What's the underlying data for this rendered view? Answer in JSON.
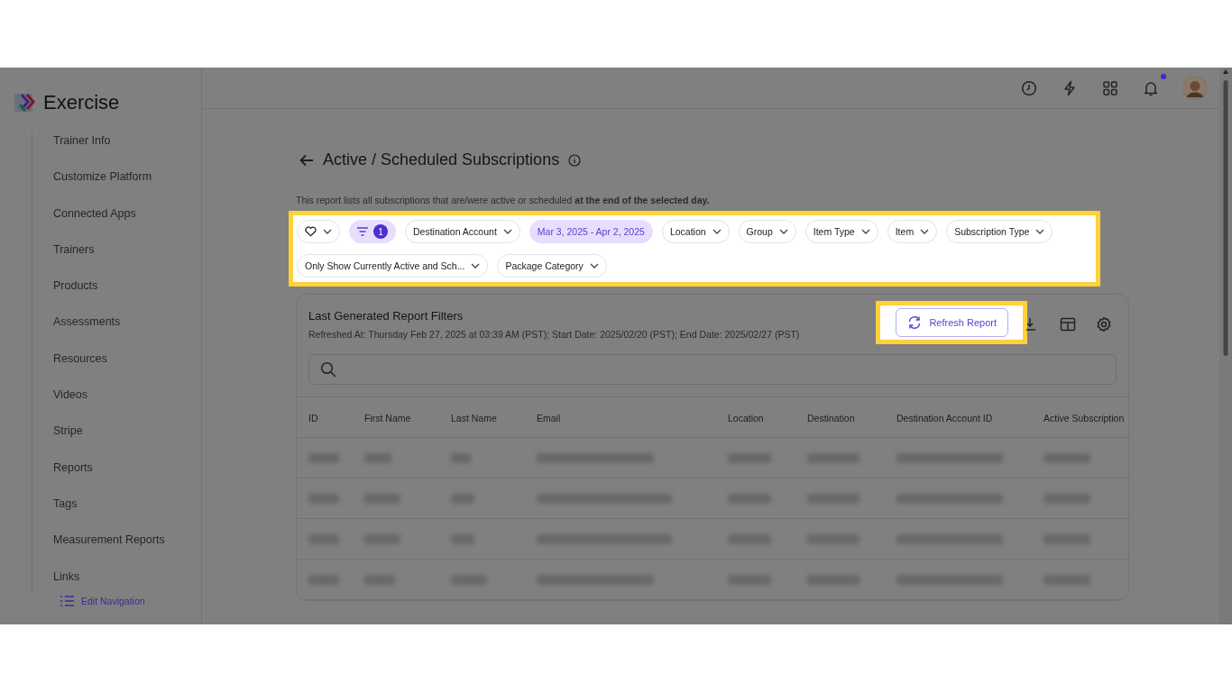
{
  "brand": {
    "name": "Exercise"
  },
  "sidebar": {
    "items": [
      "Trainer Info",
      "Customize Platform",
      "Connected Apps",
      "Trainers",
      "Products",
      "Assessments",
      "Resources",
      "Videos",
      "Stripe",
      "Reports",
      "Tags",
      "Measurement Reports",
      "Links"
    ],
    "edit_navigation": "Edit Navigation"
  },
  "header": {
    "notifications_unread": true
  },
  "page": {
    "title": "Active / Scheduled Subscriptions",
    "description": "This report lists all subscriptions that are/were active or scheduled **at the end of the selected day.**"
  },
  "filters": [
    {
      "kind": "favorite"
    },
    {
      "kind": "count",
      "label": "1"
    },
    {
      "kind": "dropdown",
      "label": "Destination Account",
      "active": false
    },
    {
      "kind": "dropdown",
      "label": "Mar 3, 2025 - Apr 2, 2025",
      "active": true
    },
    {
      "kind": "dropdown",
      "label": "Location",
      "active": false
    },
    {
      "kind": "dropdown",
      "label": "Group",
      "active": false
    },
    {
      "kind": "dropdown",
      "label": "Item Type",
      "active": false
    },
    {
      "kind": "dropdown",
      "label": "Item",
      "active": false
    },
    {
      "kind": "dropdown",
      "label": "Subscription Type",
      "active": false
    },
    {
      "kind": "dropdown",
      "label": "Only Show Currently Active and Sch...",
      "active": false
    },
    {
      "kind": "dropdown",
      "label": "Package Category",
      "active": false
    }
  ],
  "report": {
    "title": "Last Generated Report Filters",
    "refreshed": "Refreshed At: Thursday Feb 27, 2025 at 03:39 AM (PST); Start Date: 2025/02/20 (PST); End Date: 2025/02/27 (PST)",
    "refresh_button": "Refresh Report",
    "columns": [
      "ID",
      "First Name",
      "Last Name",
      "Email",
      "Location",
      "Destination",
      "Destination Account ID",
      "Active Subscription"
    ]
  }
}
